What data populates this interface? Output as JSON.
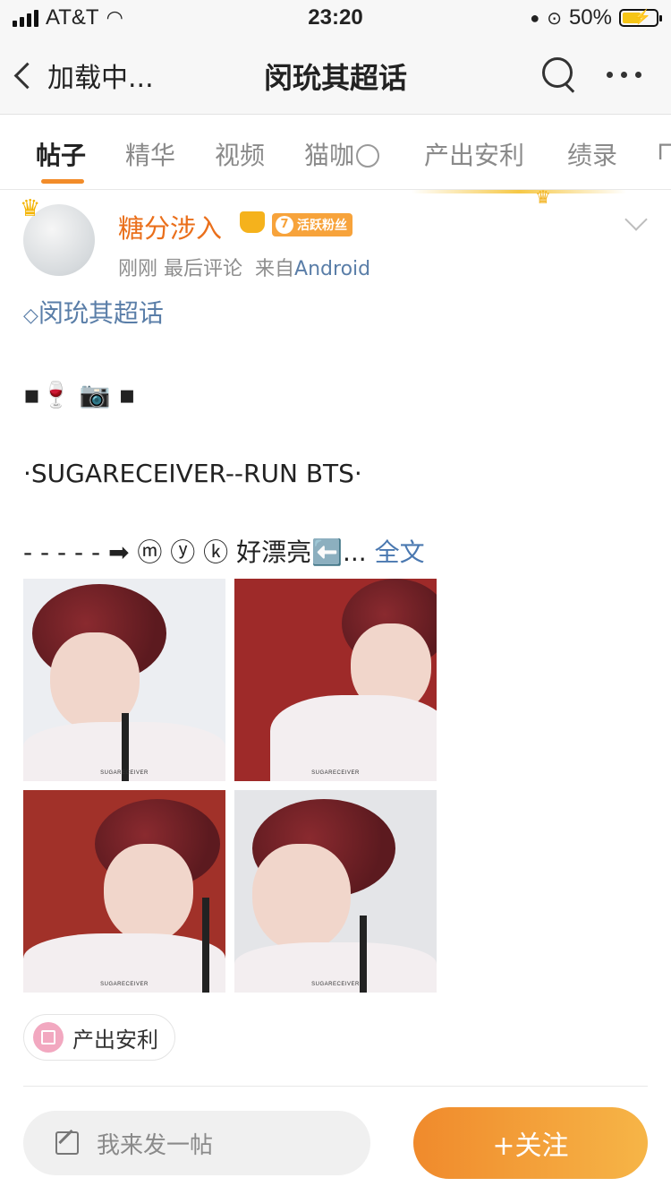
{
  "status": {
    "carrier": "AT&T",
    "time": "23:20",
    "battery": "50%",
    "battery_level": 0.5
  },
  "nav": {
    "back_label": "加载中...",
    "title": "闵玧其超话"
  },
  "tabs": [
    {
      "label": "帖子",
      "active": true
    },
    {
      "label": "精华"
    },
    {
      "label": "视频"
    },
    {
      "label": "猫咖"
    },
    {
      "label": "产出安利"
    },
    {
      "label": "绩录"
    }
  ],
  "post": {
    "username": "糖分涉入",
    "fan_badge_level": "7",
    "fan_badge_text": "活跃粉丝",
    "meta_time": "刚刚",
    "meta_action": "最后评论",
    "meta_from": "来自",
    "meta_source": "Android",
    "topic": "闵玧其超话",
    "line1": "▪🍷 📷 ▪",
    "line2": "·SUGARECEIVER--RUN BTS·",
    "line3": "- - - - - ➡ ⓜ ⓨ ⓚ 好漂亮⬅️...",
    "more_link": "全文",
    "photo_watermark": "SUGARECEIVER",
    "chip_label": "产出安利"
  },
  "bottom": {
    "compose_placeholder": "我来发一帖",
    "follow_label": "+关注"
  },
  "colors": {
    "accent_orange": "#f28c2a",
    "username_orange": "#ea6f1b",
    "link_blue": "#4a78b0"
  }
}
